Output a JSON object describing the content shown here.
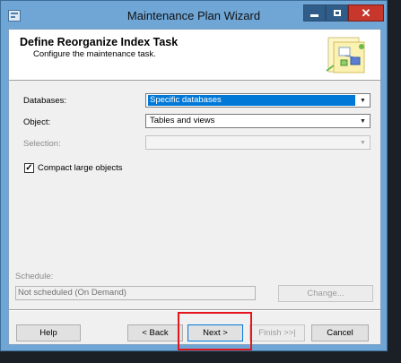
{
  "window": {
    "title": "Maintenance Plan Wizard"
  },
  "header": {
    "title": "Define Reorganize Index Task",
    "subtitle": "Configure the maintenance task."
  },
  "form": {
    "databases_label": "Databases:",
    "databases_value": "Specific databases",
    "object_label": "Object:",
    "object_value": "Tables and views",
    "selection_label": "Selection:",
    "selection_value": "",
    "compact_label": "Compact large objects",
    "compact_checked": true
  },
  "schedule": {
    "label": "Schedule:",
    "value": "Not scheduled (On Demand)",
    "change_label": "Change..."
  },
  "footer": {
    "help_label": "Help",
    "back_label": "< Back",
    "next_label": "Next >",
    "finish_label": "Finish >>|",
    "cancel_label": "Cancel"
  },
  "colors": {
    "title_bar": "#6fa6d6",
    "close_button": "#c7372b",
    "selection_highlight": "#0078d7",
    "annotation_box": "#e3161d"
  }
}
